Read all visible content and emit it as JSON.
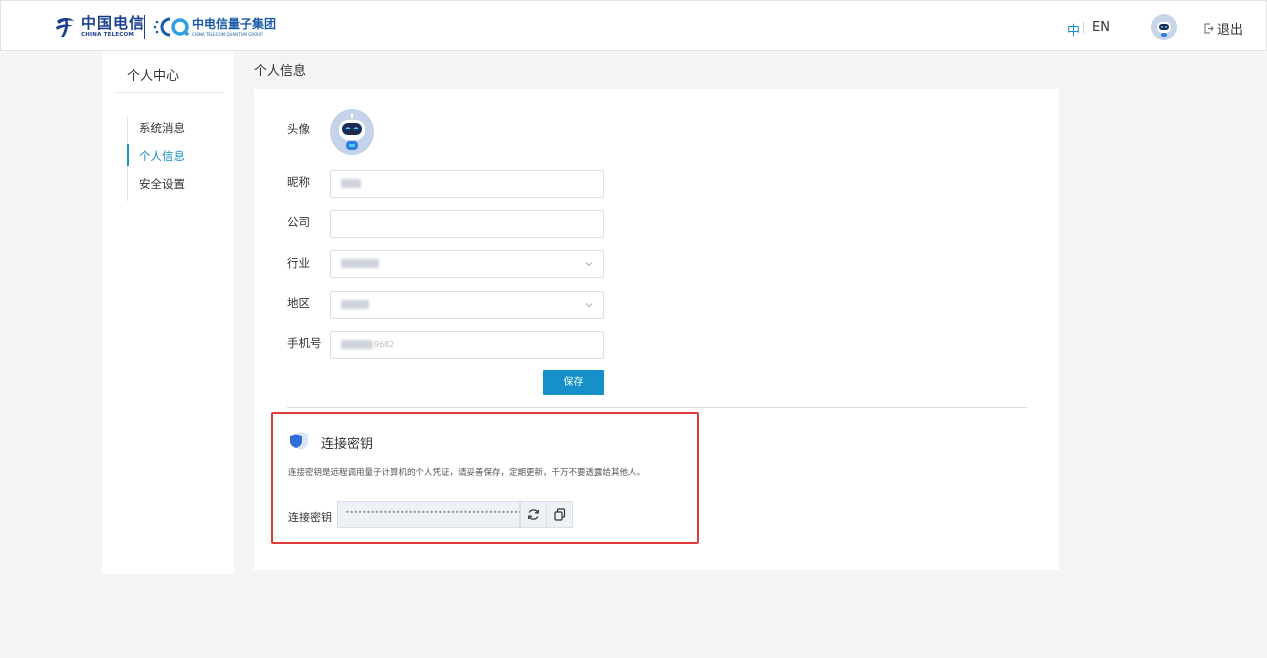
{
  "header": {
    "brand_cn": "中国电信",
    "brand_en": "CHINA TELECOM",
    "group_cn": "中电信量子集团",
    "group_en": "CHINA TELECOM QUANTUM GROUP",
    "lang_zh": "中",
    "lang_en": "EN",
    "logout_label": "退出"
  },
  "sidebar": {
    "title": "个人中心",
    "items": [
      {
        "label": "系统消息"
      },
      {
        "label": "个人信息"
      },
      {
        "label": "安全设置"
      }
    ],
    "active_index": 1
  },
  "main": {
    "title": "个人信息",
    "labels": {
      "avatar": "头像",
      "nickname": "昵称",
      "company": "公司",
      "industry": "行业",
      "region": "地区",
      "phone": "手机号"
    },
    "values": {
      "phone_suffix": "9682"
    },
    "save_label": "保存"
  },
  "key_section": {
    "title": "连接密钥",
    "description": "连接密钥是远程调用量子计算机的个人凭证，请妥善保存，定期更新，千万不要透露给其他人。",
    "label": "连接密钥",
    "masked_value": "•••••••••••••••••••••••••••••••••••••••••••"
  },
  "colors": {
    "accent": "#1890c8",
    "button": "#1590c8",
    "highlight_border": "#e03a3a"
  }
}
